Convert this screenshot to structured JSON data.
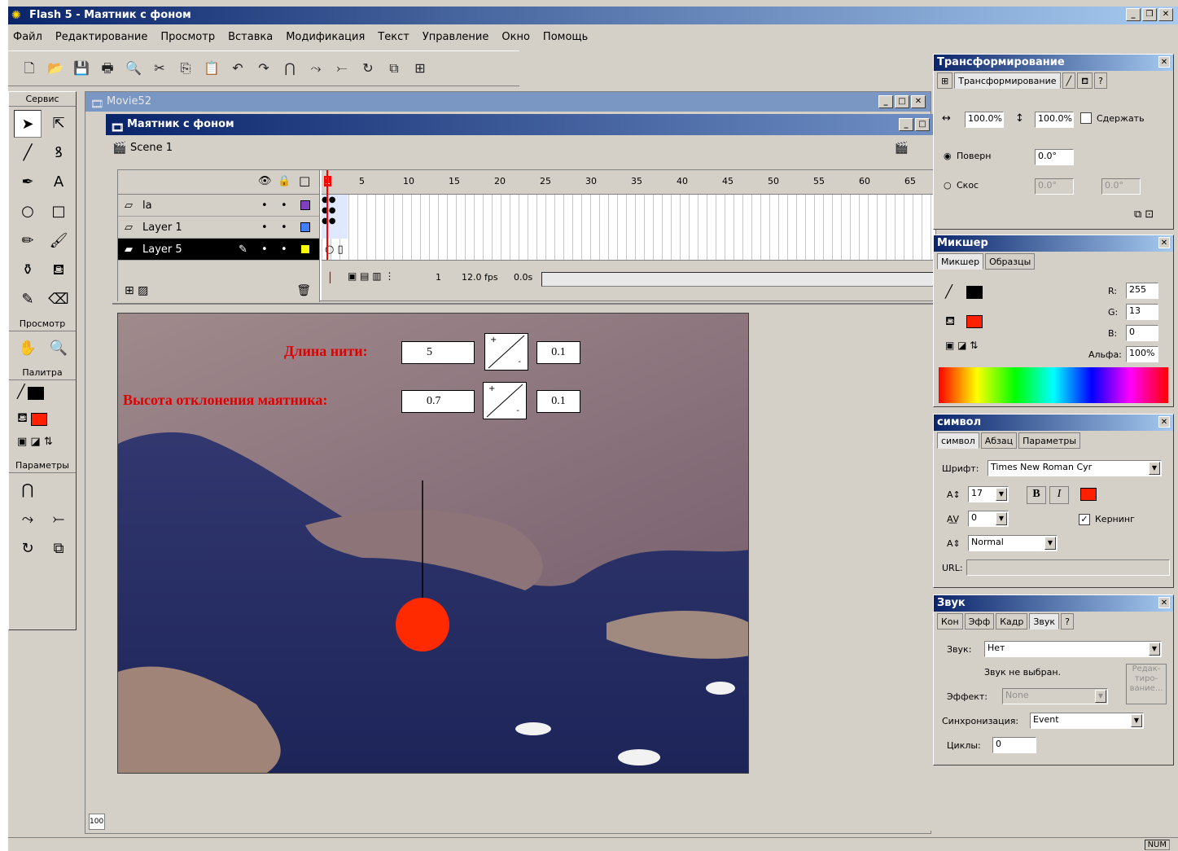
{
  "window": {
    "title": "Flash 5 - Маятник с фоном",
    "min": "_",
    "max": "❒",
    "close": "✕"
  },
  "menu": [
    "Файл",
    "Редактирование",
    "Просмотр",
    "Вставка",
    "Модификация",
    "Текст",
    "Управление",
    "Окно",
    "Помощь"
  ],
  "toolbox": {
    "sections": [
      "Сервис",
      "Просмотр",
      "Палитра",
      "Параметры"
    ],
    "stroke_color": "#000000",
    "fill_color": "#ff2000"
  },
  "movie_window": {
    "title": "Movie52",
    "zoom": "100"
  },
  "document": {
    "title": "Маятник с фоном",
    "scene": "Scene 1"
  },
  "timeline": {
    "layers": [
      {
        "name": "la"
      },
      {
        "name": "Layer 1"
      },
      {
        "name": "Layer 5"
      }
    ],
    "frame_numbers": [
      "1",
      "5",
      "10",
      "15",
      "20",
      "25",
      "30",
      "35",
      "40",
      "45",
      "50",
      "55",
      "60",
      "65"
    ],
    "current_frame": "1",
    "fps": "12.0 fps",
    "time": "0.0s"
  },
  "stage": {
    "length_label": "Длина нити:",
    "length_value": "5",
    "length_step": "0.1",
    "height_label": "Высота отклонения маятника:",
    "height_value": "0.7",
    "height_step": "0.1",
    "slider_plus": "+",
    "slider_minus": "-",
    "pendulum_color": "#ff2a00"
  },
  "transform_panel": {
    "title": "Трансформирование",
    "tab": "Трансформирование",
    "width": "100.0%",
    "height": "100.0%",
    "constrain_label": "Сдержать",
    "rotate_label": "Поверн",
    "rotate_value": "0.0°",
    "skew_label": "Скос",
    "skew_h": "0.0°",
    "skew_v": "0.0°"
  },
  "mixer_panel": {
    "title": "Микшер",
    "tabs": [
      "Микшер",
      "Образцы"
    ],
    "r_label": "R:",
    "r": "255",
    "g_label": "G:",
    "g": "13",
    "b_label": "B:",
    "b": "0",
    "alpha_label": "Альфа:",
    "alpha": "100%",
    "stroke_color": "#000000",
    "fill_color": "#ff2000"
  },
  "char_panel": {
    "title": "символ",
    "tabs": [
      "символ",
      "Абзац",
      "Параметры"
    ],
    "font_label": "Шрифт:",
    "font": "Times New Roman Cyr",
    "size": "17",
    "spacing": "0",
    "kerning_label": "Кернинг",
    "baseline": "Normal",
    "url_label": "URL:",
    "bold": "B",
    "italic": "I",
    "text_color": "#ff2000"
  },
  "sound_panel": {
    "title": "Звук",
    "tabs": [
      "Кон",
      "Эфф",
      "Кадр",
      "Звук"
    ],
    "sound_label": "Звук:",
    "sound": "Нет",
    "no_sound": "Звук не выбран.",
    "edit_btn": "Редак-тиро-вание...",
    "effect_label": "Эффект:",
    "effect": "None",
    "sync_label": "Синхронизация:",
    "sync": "Event",
    "loops_label": "Циклы:",
    "loops": "0"
  },
  "status": {
    "num": "NUM"
  }
}
